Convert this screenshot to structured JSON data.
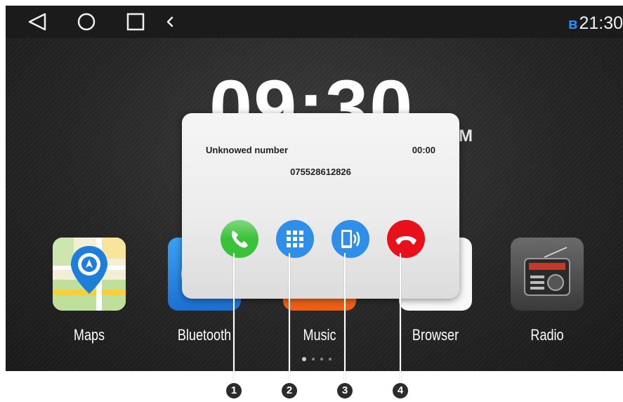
{
  "status_bar": {
    "nav_icons": [
      "back-icon",
      "home-icon",
      "recents-icon",
      "chevron-left-icon"
    ],
    "bluetooth_icon": "bluetooth-icon",
    "time": "21:30",
    "bluetooth_glyph": "ʙ"
  },
  "home": {
    "clock": "09:30",
    "ampm_fragment": "M",
    "apps": [
      {
        "label": "Maps",
        "icon": "maps-icon"
      },
      {
        "label": "Bluetooth",
        "icon": "bluetooth-app-icon"
      },
      {
        "label": "Music",
        "icon": "music-icon"
      },
      {
        "label": "Browser",
        "icon": "browser-icon"
      },
      {
        "label": "Radio",
        "icon": "radio-icon"
      }
    ],
    "page_indicator": {
      "pages": 4,
      "current": 1
    }
  },
  "call_dialog": {
    "caller_name": "Unknowed number",
    "timer": "00:00",
    "number": "075528612826",
    "buttons": [
      {
        "name": "answer-call-button",
        "icon": "phone-icon",
        "color": "#3ac23a"
      },
      {
        "name": "dialpad-button",
        "icon": "dialpad-icon",
        "color": "#2f8fe8"
      },
      {
        "name": "switch-to-phone-button",
        "icon": "phone-speaker-icon",
        "color": "#2f8fe8"
      },
      {
        "name": "hang-up-button",
        "icon": "hang-up-icon",
        "color": "#e8101a"
      }
    ]
  },
  "callouts": [
    "1",
    "2",
    "3",
    "4"
  ],
  "colors": {
    "status_bar_bg": "#1b1b1b",
    "background": "#2a2a2a",
    "bluetooth_blue": "#2a8cf0",
    "dialog_bg": "#eeeeee",
    "answer_green": "#3ac23a",
    "action_blue": "#2f8fe8",
    "hangup_red": "#e8101a"
  }
}
